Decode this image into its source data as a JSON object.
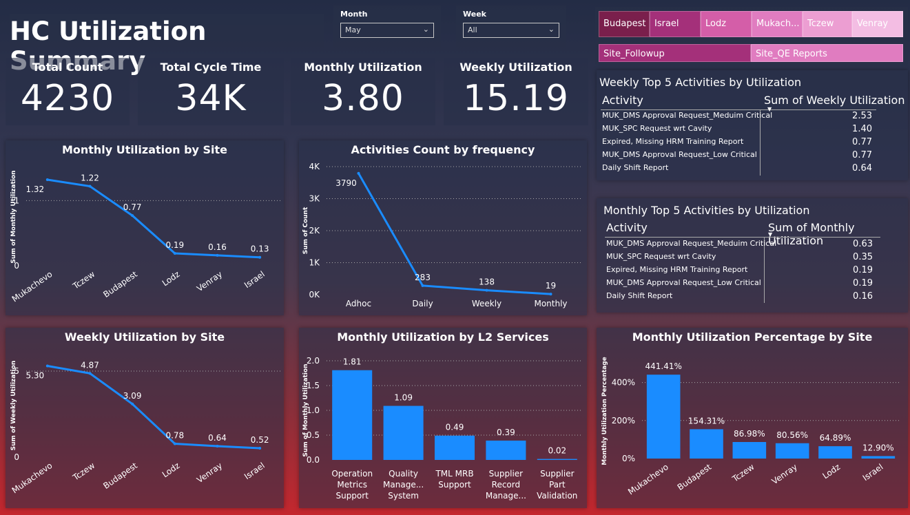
{
  "header": {
    "title": "HC Utilization Summary"
  },
  "filters": {
    "month_label": "Month",
    "month_value": "May",
    "week_label": "Week",
    "week_value": "All"
  },
  "kpis": [
    {
      "label": "Total Count",
      "value": "4230"
    },
    {
      "label": "Total Cycle Time",
      "value": "34K"
    },
    {
      "label": "Monthly Utilization",
      "value": "3.80"
    },
    {
      "label": "Weekly Utilization",
      "value": "15.19"
    }
  ],
  "site_chips": [
    {
      "label": "Budapest",
      "color": "#7a1f4c"
    },
    {
      "label": "Israel",
      "color": "#a4307a"
    },
    {
      "label": "Lodz",
      "color": "#d45ea8"
    },
    {
      "label": "Mukach...",
      "color": "#e07cc0"
    },
    {
      "label": "Tczew",
      "color": "#ec9ed2"
    },
    {
      "label": "Venray",
      "color": "#f3bde3"
    }
  ],
  "report_chips": [
    {
      "label": "Site_Followup",
      "color": "#a4307a"
    },
    {
      "label": "Site_QE Reports",
      "color": "#e07cc0"
    }
  ],
  "weekly_table": {
    "title": "Weekly Top 5 Activities by Utilization",
    "col1": "Activity",
    "col2": "Sum of Weekly Utilization",
    "rows": [
      {
        "a": "MUK_DMS Approval Request_Meduim Critical",
        "v": "2.53"
      },
      {
        "a": "MUK_SPC Request wrt Cavity",
        "v": "1.40"
      },
      {
        "a": "Expired, Missing HRM Training Report",
        "v": "0.77"
      },
      {
        "a": "MUK_DMS Approval Request_Low Critical",
        "v": "0.77"
      },
      {
        "a": "Daily Shift Report",
        "v": "0.64"
      }
    ]
  },
  "monthly_table": {
    "title": "Monthly Top 5 Activities by Utilization",
    "col1": "Activity",
    "col2": "Sum of Monthly Utilization",
    "rows": [
      {
        "a": "MUK_DMS Approval Request_Meduim Critical",
        "v": "0.63"
      },
      {
        "a": "MUK_SPC Request wrt Cavity",
        "v": "0.35"
      },
      {
        "a": "Expired, Missing HRM Training Report",
        "v": "0.19"
      },
      {
        "a": "MUK_DMS Approval Request_Low Critical",
        "v": "0.19"
      },
      {
        "a": "Daily Shift Report",
        "v": "0.16"
      }
    ]
  },
  "chart_data": [
    {
      "id": "monthly_site",
      "type": "line",
      "title": "Monthly Utilization by Site",
      "ylabel": "Sum of Monthly Utilization",
      "categories": [
        "Mukachevo",
        "Tczew",
        "Budapest",
        "Lodz",
        "Venray",
        "Israel"
      ],
      "values": [
        1.32,
        1.22,
        0.77,
        0.19,
        0.16,
        0.13
      ],
      "labels": [
        "1.32",
        "1.22",
        "0.77",
        "0.19",
        "0.16",
        "0.13"
      ],
      "ylim": [
        0,
        1.5
      ],
      "ticks": [
        0,
        1
      ],
      "tick_labels": [
        "0",
        "1"
      ],
      "color": "#1a8cff"
    },
    {
      "id": "freq",
      "type": "line",
      "title": "Activities Count by frequency",
      "ylabel": "Sum of Count",
      "categories": [
        "Adhoc",
        "Daily",
        "Weekly",
        "Monthly"
      ],
      "values": [
        3790,
        283,
        138,
        19
      ],
      "labels": [
        "3790",
        "283",
        "138",
        "19"
      ],
      "ylim": [
        0,
        4000
      ],
      "ticks": [
        0,
        1000,
        2000,
        3000,
        4000
      ],
      "tick_labels": [
        "0K",
        "1K",
        "2K",
        "3K",
        "4K"
      ],
      "color": "#1a8cff"
    },
    {
      "id": "weekly_site",
      "type": "line",
      "title": "Weekly Utilization by Site",
      "ylabel": "Sum of Weekly Utilization",
      "categories": [
        "Mukachevo",
        "Tczew",
        "Budapest",
        "Lodz",
        "Venray",
        "Israel"
      ],
      "values": [
        5.3,
        4.87,
        3.09,
        0.78,
        0.64,
        0.52
      ],
      "labels": [
        "5.30",
        "4.87",
        "3.09",
        "0.78",
        "0.64",
        "0.52"
      ],
      "ylim": [
        0,
        6
      ],
      "ticks": [
        0,
        5
      ],
      "tick_labels": [
        "0",
        "5"
      ],
      "color": "#1a8cff"
    },
    {
      "id": "l2",
      "type": "bar",
      "title": "Monthly Utilization by L2 Services",
      "ylabel": "Sum of Monthly Utilization",
      "categories": [
        [
          "Operation",
          "Metrics",
          "Support"
        ],
        [
          "Quality",
          "Manage...",
          "System"
        ],
        [
          "TML MRB",
          "Support"
        ],
        [
          "Supplier",
          "Record",
          "Manage..."
        ],
        [
          "Supplier",
          "Part",
          "Validation"
        ]
      ],
      "values": [
        1.81,
        1.09,
        0.49,
        0.39,
        0.02
      ],
      "labels": [
        "1.81",
        "1.09",
        "0.49",
        "0.39",
        "0.02"
      ],
      "ylim": [
        0,
        2.0
      ],
      "ticks": [
        0,
        0.5,
        1.0,
        1.5,
        2.0
      ],
      "tick_labels": [
        "0.0",
        "0.5",
        "1.0",
        "1.5",
        "2.0"
      ],
      "color": "#1a8cff"
    },
    {
      "id": "pct",
      "type": "bar",
      "title": "Monthly Utilization Percentage by Site",
      "ylabel": "Monthly Utilization Percentage",
      "categories": [
        "Mukachevo",
        "Budapest",
        "Tczew",
        "Venray",
        "Lodz",
        "Israel"
      ],
      "values": [
        441.41,
        154.31,
        86.98,
        80.56,
        64.89,
        12.9
      ],
      "labels": [
        "441.41%",
        "154.31%",
        "86.98%",
        "80.56%",
        "64.89%",
        "12.90%"
      ],
      "ylim": [
        0,
        500
      ],
      "ticks": [
        0,
        200,
        400
      ],
      "tick_labels": [
        "0%",
        "200%",
        "400%"
      ],
      "color": "#1a8cff",
      "rotated": true
    }
  ]
}
